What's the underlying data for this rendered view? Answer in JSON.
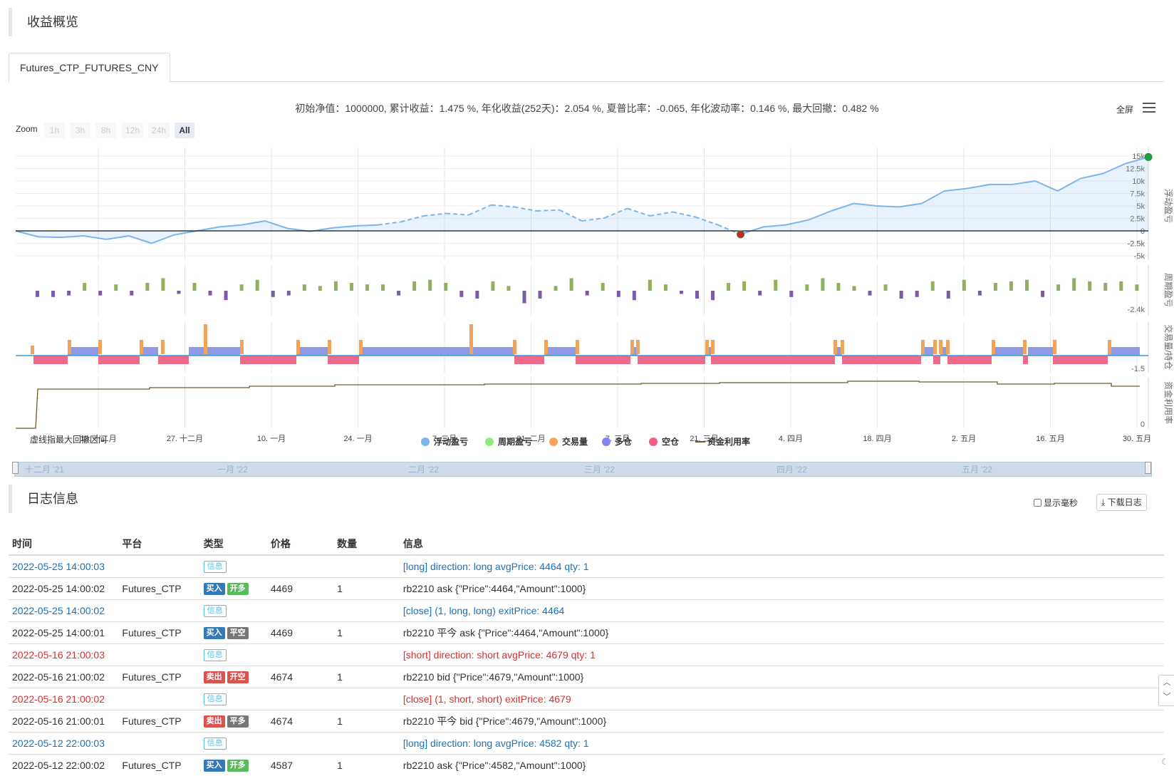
{
  "overview": {
    "title": "收益概览"
  },
  "tab": {
    "label": "Futures_CTP_FUTURES_CNY"
  },
  "summary": "初始净值：1000000, 累计收益：1.475 %, 年化收益(252天)：2.054 %, 夏普比率：-0.065, 年化波动率：0.146 %, 最大回撤：0.482 %",
  "toolbar": {
    "fullscreen": "全屏",
    "menu_icon": "hamburger-menu-icon"
  },
  "zoom": {
    "label": "Zoom",
    "buttons": [
      "1h",
      "3h",
      "8h",
      "12h",
      "24h",
      "All"
    ],
    "active": "All"
  },
  "chart_data": [
    {
      "type": "line",
      "name": "浮动盈亏",
      "ylabel": "浮动盈亏",
      "y_ticks": [
        "15k",
        "12.5k",
        "10k",
        "7.5k",
        "5k",
        "2.5k",
        "0",
        "-2.5k",
        "-5k"
      ],
      "ylim": [
        -5000,
        15000
      ],
      "x": [
        0,
        2,
        4,
        6,
        8,
        10,
        12,
        14,
        16,
        18,
        20,
        22,
        24,
        26,
        28,
        30,
        32,
        34,
        36,
        38,
        40,
        42,
        44,
        46,
        48,
        50,
        52,
        54,
        56,
        58,
        60,
        62,
        64,
        66,
        68,
        70,
        72,
        74,
        76,
        78,
        80,
        82,
        84,
        86,
        88,
        90,
        92,
        94,
        96,
        98,
        100
      ],
      "values": [
        0,
        -1200,
        -1300,
        -1000,
        -1700,
        -1000,
        -2500,
        -800,
        0,
        800,
        1200,
        2000,
        500,
        -100,
        600,
        1000,
        1200,
        1800,
        3000,
        3500,
        3200,
        5200,
        4800,
        4000,
        4200,
        2000,
        2600,
        4500,
        3000,
        3800,
        2800,
        1200,
        -700,
        800,
        1200,
        2200,
        4000,
        5500,
        5000,
        4800,
        5500,
        8000,
        8500,
        9300,
        9300,
        10000,
        8000,
        10500,
        11500,
        13500,
        14800
      ],
      "dashed_range": [
        31,
        64
      ],
      "markers": [
        {
          "x": 64,
          "y": -700,
          "color": "#d0221f"
        },
        {
          "x": 100,
          "y": 14800,
          "color": "#1ca13b"
        }
      ]
    },
    {
      "type": "bar",
      "name": "周期盈亏",
      "ylabel": "周期盈亏",
      "min_label": "-2.4k",
      "values": [
        -0.4,
        -0.4,
        -0.3,
        0.5,
        -0.3,
        0.4,
        -0.3,
        0.5,
        0.8,
        -0.2,
        0.5,
        -0.3,
        -0.6,
        0.4,
        0.7,
        -0.4,
        -0.3,
        0.4,
        0.3,
        0.6,
        0.5,
        0.4,
        0.4,
        -0.3,
        0.6,
        0.7,
        0.5,
        -0.4,
        -0.5,
        0.6,
        0.3,
        -0.8,
        -0.5,
        0.3,
        0.8,
        -0.3,
        0.5,
        -0.4,
        -0.6,
        0.7,
        0.4,
        -0.2,
        -0.5,
        -0.6,
        0.5,
        0.6,
        -0.3,
        0.7,
        -0.4,
        0.4,
        0.8,
        0.5,
        0.3,
        -0.3,
        0.4,
        -0.5,
        -0.4,
        0.6,
        -0.5,
        0.7,
        -0.3,
        0.5,
        0.6,
        0.7,
        -0.4,
        0.4,
        0.8,
        0.6,
        0.5,
        0.6,
        0.4,
        -0.4,
        0.5,
        0.7,
        0.6
      ]
    },
    {
      "type": "area",
      "name": "交易量/持仓",
      "ylabel": "交易量/持仓",
      "min_label": "-1.5",
      "long_color": "#8f9ae7",
      "short_color": "#ec6b8a",
      "volume_color": "#f0a35c"
    },
    {
      "type": "line",
      "name": "资金利用率",
      "ylabel": "资金利用率",
      "zero_label": "0",
      "color": "#6b5a2a"
    }
  ],
  "x_axis": {
    "labels": [
      "13. 十二月",
      "27. 十二月",
      "10. 一月",
      "24. 一月",
      "7. 二月",
      "21. 二月",
      "7. 三月",
      "21. 三月",
      "4. 四月",
      "18. 四月",
      "2. 五月",
      "16. 五月",
      "30. 五月"
    ]
  },
  "note": "虚线指最大回撤区间",
  "legend": [
    {
      "label": "浮动盈亏",
      "color": "#7cb5ec"
    },
    {
      "label": "周期盈亏",
      "color": "#90ed7d"
    },
    {
      "label": "交易量",
      "color": "#f7a35c"
    },
    {
      "label": "多仓",
      "color": "#8085e9"
    },
    {
      "label": "空仓",
      "color": "#f15c80"
    },
    {
      "label": "资金利用率",
      "color": "#6b5a2a"
    }
  ],
  "navigator": {
    "labels": [
      "十二月 '21",
      "一月 '22",
      "二月 '22",
      "三月 '22",
      "四月 '22",
      "五月 '22"
    ]
  },
  "log": {
    "title": "日志信息",
    "show_ms": "显示毫秒",
    "download": "下载日志",
    "columns": [
      "时间",
      "平台",
      "类型",
      "价格",
      "数量",
      "信息"
    ],
    "rows": [
      {
        "time": "2022-05-25 14:00:03",
        "platform": "",
        "type": "info",
        "badges": [
          "信息"
        ],
        "price": "",
        "qty": "",
        "msg": "[long] direction: long avgPrice: 4464 qty: 1",
        "color": "blue"
      },
      {
        "time": "2022-05-25 14:00:02",
        "platform": "Futures_CTP",
        "type": "trade",
        "badges": [
          "买入",
          "开多"
        ],
        "price": "4469",
        "qty": "1",
        "msg": "rb2210 ask {\"Price\":4464,\"Amount\":1000}",
        "color": "normal"
      },
      {
        "time": "2022-05-25 14:00:02",
        "platform": "",
        "type": "info",
        "badges": [
          "信息"
        ],
        "price": "",
        "qty": "",
        "msg": "[close] (1, long, long) exitPrice: 4464",
        "color": "blue"
      },
      {
        "time": "2022-05-25 14:00:01",
        "platform": "Futures_CTP",
        "type": "trade",
        "badges": [
          "买入",
          "平空"
        ],
        "price": "4469",
        "qty": "1",
        "msg": "rb2210 平今 ask {\"Price\":4464,\"Amount\":1000}",
        "color": "normal"
      },
      {
        "time": "2022-05-16 21:00:03",
        "platform": "",
        "type": "info",
        "badges": [
          "信息"
        ],
        "price": "",
        "qty": "",
        "msg": "[short] direction: short avgPrice: 4679 qty: 1",
        "color": "red"
      },
      {
        "time": "2022-05-16 21:00:02",
        "platform": "Futures_CTP",
        "type": "trade",
        "badges": [
          "卖出",
          "开空"
        ],
        "price": "4674",
        "qty": "1",
        "msg": "rb2210 bid {\"Price\":4679,\"Amount\":1000}",
        "color": "normal"
      },
      {
        "time": "2022-05-16 21:00:02",
        "platform": "",
        "type": "info",
        "badges": [
          "信息"
        ],
        "price": "",
        "qty": "",
        "msg": "[close] (1, short, short) exitPrice: 4679",
        "color": "red"
      },
      {
        "time": "2022-05-16 21:00:01",
        "platform": "Futures_CTP",
        "type": "trade",
        "badges": [
          "卖出",
          "平多"
        ],
        "price": "4674",
        "qty": "1",
        "msg": "rb2210 平今 bid {\"Price\":4679,\"Amount\":1000}",
        "color": "normal"
      },
      {
        "time": "2022-05-12 22:00:03",
        "platform": "",
        "type": "info",
        "badges": [
          "信息"
        ],
        "price": "",
        "qty": "",
        "msg": "[long] direction: long avgPrice: 4582 qty: 1",
        "color": "blue"
      },
      {
        "time": "2022-05-12 22:00:02",
        "platform": "Futures_CTP",
        "type": "trade",
        "badges": [
          "买入",
          "开多"
        ],
        "price": "4587",
        "qty": "1",
        "msg": "rb2210 ask {\"Price\":4582,\"Amount\":1000}",
        "color": "normal"
      }
    ]
  }
}
